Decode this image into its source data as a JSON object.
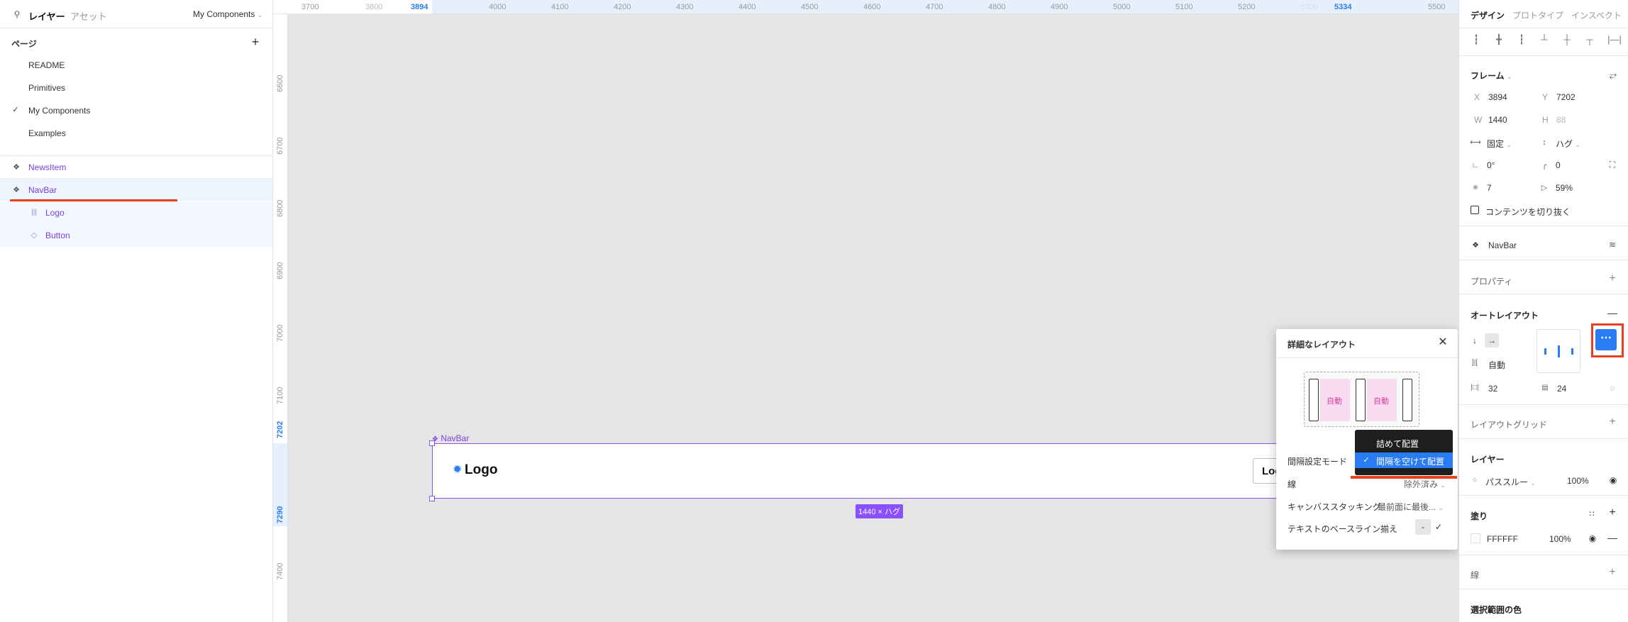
{
  "left_panel": {
    "tabs": {
      "layers": "レイヤー",
      "assets": "アセット"
    },
    "page_selector": "My Components",
    "pages_title": "ページ",
    "pages": [
      "README",
      "Primitives",
      "My Components",
      "Examples"
    ],
    "layers": [
      {
        "label": "NewsItem"
      },
      {
        "label": "NavBar"
      },
      {
        "label": "Logo"
      },
      {
        "label": "Button"
      }
    ]
  },
  "ruler": {
    "h_ticks": [
      "3700",
      "3800",
      "3894",
      "4000",
      "4100",
      "4200",
      "4300",
      "4400",
      "4500",
      "4600",
      "4700",
      "4800",
      "4900",
      "5000",
      "5100",
      "5200",
      "5300",
      "5334",
      "5500"
    ],
    "v_ticks": [
      "6600",
      "6700",
      "6800",
      "6900",
      "7000",
      "7100",
      "7202",
      "7290",
      "7400"
    ]
  },
  "canvas": {
    "frame_label": "NavBar",
    "logo_text": "Logo",
    "button_text_partial": "Log",
    "size_badge": "1440 × ハグ"
  },
  "right_panel": {
    "tabs": {
      "design": "デザイン",
      "prototype": "プロトタイプ",
      "inspect": "インスペクト"
    },
    "frame_title": "フレーム",
    "x_label": "X",
    "x_value": "3894",
    "y_label": "Y",
    "y_value": "7202",
    "w_label": "W",
    "w_value": "1440",
    "h_label": "H",
    "h_value": "88",
    "width_mode": "固定",
    "height_mode": "ハグ",
    "rotation": "0°",
    "radius": "0",
    "count": "7",
    "percent": "59%",
    "clip_content": "コンテンツを切り抜く",
    "component_name": "NavBar",
    "properties_title": "プロパティ",
    "autolayout_title": "オートレイアウト",
    "spacing_auto": "自動",
    "padding_h": "32",
    "padding_v": "24",
    "layout_grid_title": "レイアウトグリッド",
    "layer_title": "レイヤー",
    "blend_mode": "パススルー",
    "layer_opacity": "100%",
    "fill_title": "塗り",
    "fill_hex": "FFFFFF",
    "fill_opacity": "100%",
    "stroke_title": "線",
    "selection_colors_title": "選択範囲の色",
    "accent": "#2a7cf5",
    "highlight": "#e8401c"
  },
  "popup": {
    "title": "詳細なレイアウト",
    "preview_auto_1": "自動",
    "preview_auto_2": "自動",
    "spacing_mode_label": "間隔設定モード",
    "stroke_label": "線",
    "stroke_value": "除外済み",
    "canvas_stacking_label": "キャンバススタッキング",
    "canvas_stacking_value": "最前面に最後...",
    "baseline_label": "テキストのベースライン揃え",
    "baseline_value": "-",
    "dropdown_options": [
      "詰めて配置",
      "間隔を空けて配置"
    ],
    "dropdown_selected": "間隔を空けて配置"
  }
}
